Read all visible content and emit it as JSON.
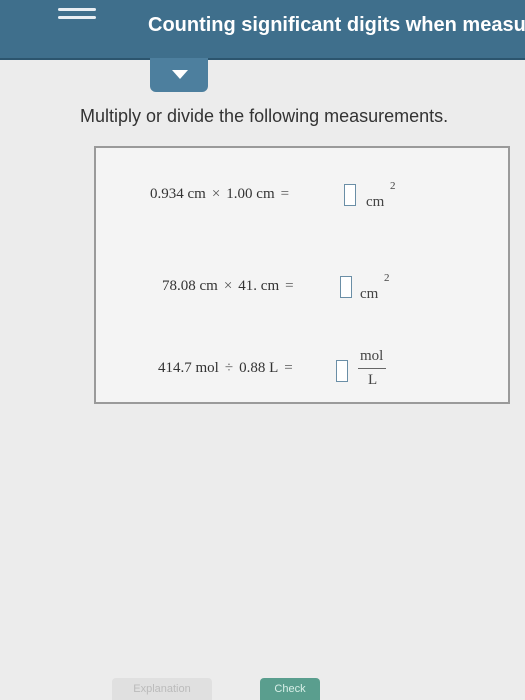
{
  "header": {
    "title": "Counting significant digits when measu"
  },
  "instruction": "Multiply or divide the following measurements.",
  "problems": [
    {
      "expr_a": "0.934 cm",
      "op": "×",
      "expr_b": "1.00 cm",
      "eq": "=",
      "unit": "cm",
      "exponent": "2"
    },
    {
      "expr_a": "78.08 cm",
      "op": "×",
      "expr_b": "41. cm",
      "eq": "=",
      "unit": "cm",
      "exponent": "2"
    },
    {
      "expr_a": "414.7 mol",
      "op": "÷",
      "expr_b": "0.88 L",
      "eq": "=",
      "unit_numerator": "mol",
      "unit_denominator": "L"
    }
  ],
  "footer": {
    "explanation_label": "Explanation",
    "check_label": "Check"
  }
}
